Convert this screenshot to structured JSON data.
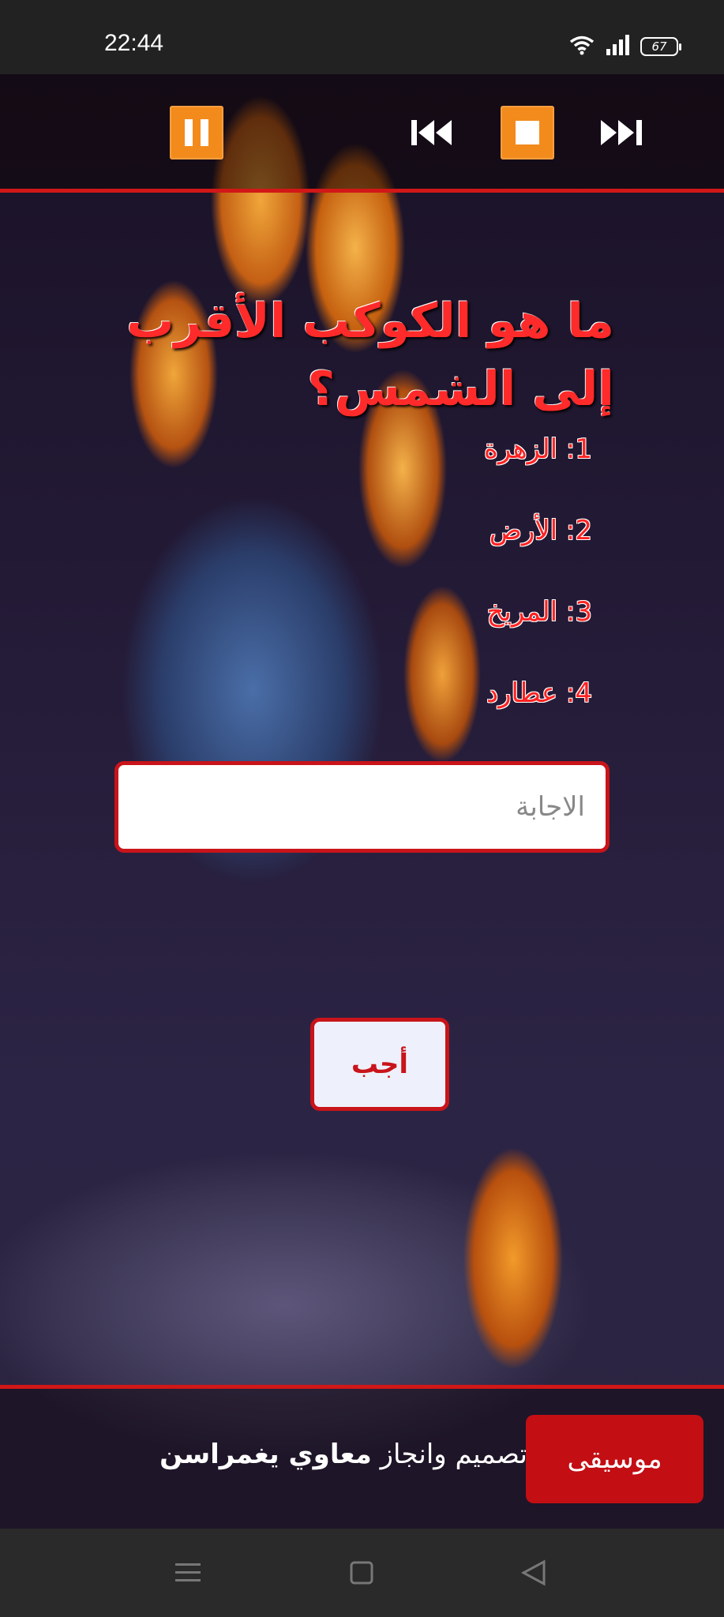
{
  "statusbar": {
    "time": "22:44",
    "battery": "67",
    "icons": [
      "wifi-icon",
      "signal-icon",
      "battery-icon"
    ]
  },
  "player": {
    "controls": [
      "pause-icon",
      "previous-icon",
      "stop-icon",
      "next-icon"
    ],
    "accent_color": "#f28b1c"
  },
  "quiz": {
    "question": "ما هو الكوكب الأقرب إلى الشمس؟",
    "options": [
      {
        "label": "1: الزهرة"
      },
      {
        "label": "2: الأرض"
      },
      {
        "label": "3: المريخ"
      },
      {
        "label": "4: عطارد"
      }
    ],
    "answer_placeholder": "الاجابة",
    "answer_value": "",
    "submit_label": "أجب"
  },
  "footer": {
    "credit_prefix": "تصميم وانجاز",
    "credit_name": "معاوي يغمراسن",
    "music_label": "موسيقى"
  },
  "navbar": {
    "icons": [
      "menu-icon",
      "home-icon",
      "back-icon"
    ]
  },
  "theme": {
    "red": "#c8141a",
    "line_red": "#d11717"
  }
}
